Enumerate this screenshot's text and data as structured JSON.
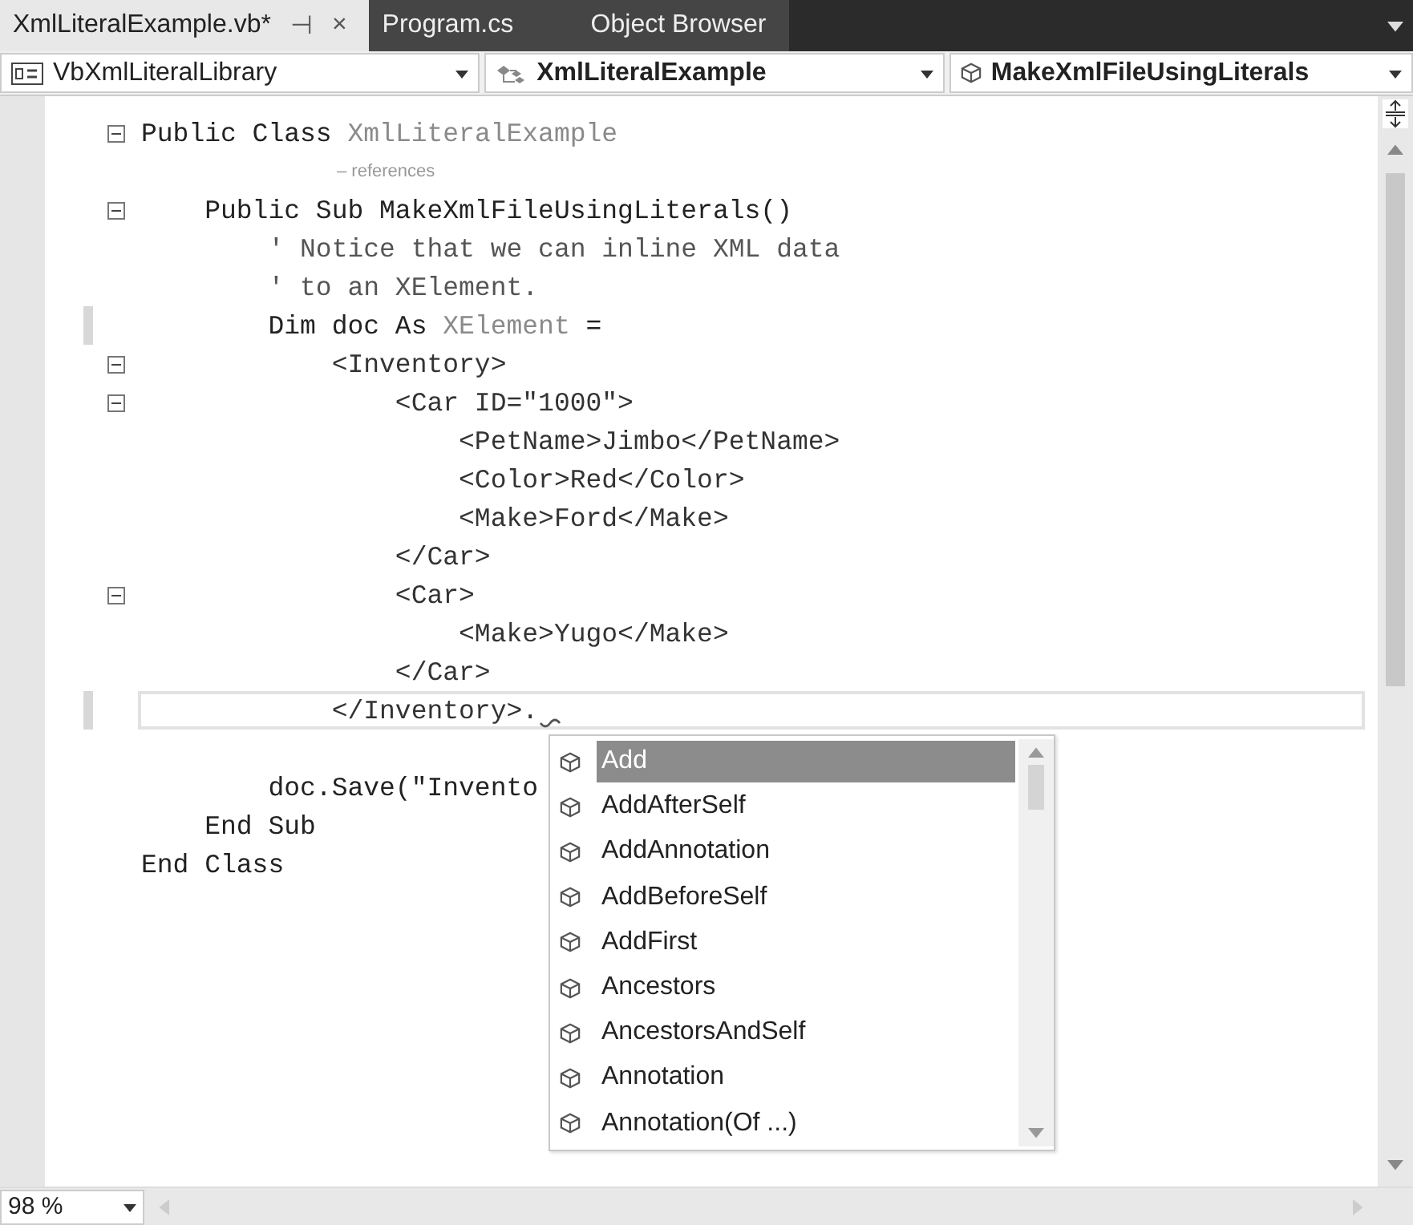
{
  "tabs": [
    {
      "label": "XmlLiteralExample.vb*",
      "selected": true,
      "pin": "⊣",
      "close": "×"
    },
    {
      "label": "Program.cs",
      "selected": false
    },
    {
      "label": "Object Browser",
      "selected": false
    }
  ],
  "navigation": [
    {
      "label": "VbXmlLiteralLibrary",
      "kind": "project"
    },
    {
      "label": "XmlLiteralExample",
      "kind": "class"
    },
    {
      "label": "MakeXmlFileUsingLiterals",
      "kind": "method"
    }
  ],
  "code_lines": [
    {
      "kind": "code",
      "fold": true,
      "changed": false,
      "current": false,
      "segments": [
        {
          "text": "Public Class ",
          "kind": "keyword"
        },
        {
          "text": "XmlLiteralExample",
          "kind": "type"
        }
      ]
    },
    {
      "kind": "codelens",
      "fold": false,
      "changed": false,
      "current": false,
      "segments": [
        {
          "text": "– references",
          "kind": "lens"
        }
      ]
    },
    {
      "kind": "code",
      "fold": true,
      "changed": false,
      "current": false,
      "segments": [
        {
          "text": "    Public Sub MakeXmlFileUsingLiterals()",
          "kind": "keyword"
        }
      ]
    },
    {
      "kind": "code",
      "fold": false,
      "changed": false,
      "current": false,
      "segments": [
        {
          "text": "        ' Notice that we can inline XML data",
          "kind": "comment"
        }
      ]
    },
    {
      "kind": "code",
      "fold": false,
      "changed": false,
      "current": false,
      "segments": [
        {
          "text": "        ' to an XElement.",
          "kind": "comment"
        }
      ]
    },
    {
      "kind": "code",
      "fold": false,
      "changed": true,
      "current": false,
      "segments": [
        {
          "text": "        Dim doc As ",
          "kind": "keyword"
        },
        {
          "text": "XElement",
          "kind": "type"
        },
        {
          "text": " =",
          "kind": "keyword"
        }
      ]
    },
    {
      "kind": "code",
      "fold": true,
      "changed": false,
      "current": false,
      "segments": [
        {
          "text": "            <Inventory>",
          "kind": "xml"
        }
      ]
    },
    {
      "kind": "code",
      "fold": true,
      "changed": false,
      "current": false,
      "segments": [
        {
          "text": "                <Car ID=\"1000\">",
          "kind": "xml"
        }
      ]
    },
    {
      "kind": "code",
      "fold": false,
      "changed": false,
      "current": false,
      "segments": [
        {
          "text": "                    <PetName>Jimbo</PetName>",
          "kind": "xml"
        }
      ]
    },
    {
      "kind": "code",
      "fold": false,
      "changed": false,
      "current": false,
      "segments": [
        {
          "text": "                    <Color>Red</Color>",
          "kind": "xml"
        }
      ]
    },
    {
      "kind": "code",
      "fold": false,
      "changed": false,
      "current": false,
      "segments": [
        {
          "text": "                    <Make>Ford</Make>",
          "kind": "xml"
        }
      ]
    },
    {
      "kind": "code",
      "fold": false,
      "changed": false,
      "current": false,
      "segments": [
        {
          "text": "                </Car>",
          "kind": "xml"
        }
      ]
    },
    {
      "kind": "code",
      "fold": true,
      "changed": false,
      "current": false,
      "segments": [
        {
          "text": "                <Car>",
          "kind": "xml"
        }
      ]
    },
    {
      "kind": "code",
      "fold": false,
      "changed": false,
      "current": false,
      "segments": [
        {
          "text": "                    <Make>Yugo</Make>",
          "kind": "xml"
        }
      ]
    },
    {
      "kind": "code",
      "fold": false,
      "changed": false,
      "current": false,
      "segments": [
        {
          "text": "                </Car>",
          "kind": "xml"
        }
      ]
    },
    {
      "kind": "code",
      "fold": false,
      "changed": true,
      "current": true,
      "segments": [
        {
          "text": "            </Inventory>.",
          "kind": "xml"
        }
      ]
    },
    {
      "kind": "blank",
      "fold": false,
      "changed": false,
      "current": false
    },
    {
      "kind": "code",
      "fold": false,
      "changed": false,
      "current": false,
      "segments": [
        {
          "text": "        doc.Save(\"Invento",
          "kind": "keyword"
        }
      ]
    },
    {
      "kind": "code",
      "fold": false,
      "changed": false,
      "current": false,
      "segments": [
        {
          "text": "    End Sub",
          "kind": "keyword"
        }
      ]
    },
    {
      "kind": "code",
      "fold": false,
      "changed": false,
      "current": false,
      "segments": [
        {
          "text": "End Class",
          "kind": "keyword"
        }
      ]
    }
  ],
  "completion": {
    "items": [
      {
        "label": "Add",
        "selected": true
      },
      {
        "label": "AddAfterSelf",
        "selected": false
      },
      {
        "label": "AddAnnotation",
        "selected": false
      },
      {
        "label": "AddBeforeSelf",
        "selected": false
      },
      {
        "label": "AddFirst",
        "selected": false
      },
      {
        "label": "Ancestors",
        "selected": false
      },
      {
        "label": "AncestorsAndSelf",
        "selected": false
      },
      {
        "label": "Annotation",
        "selected": false
      },
      {
        "label": "Annotation(Of ...)",
        "selected": false
      }
    ]
  },
  "zoom": {
    "value": "98 %"
  }
}
